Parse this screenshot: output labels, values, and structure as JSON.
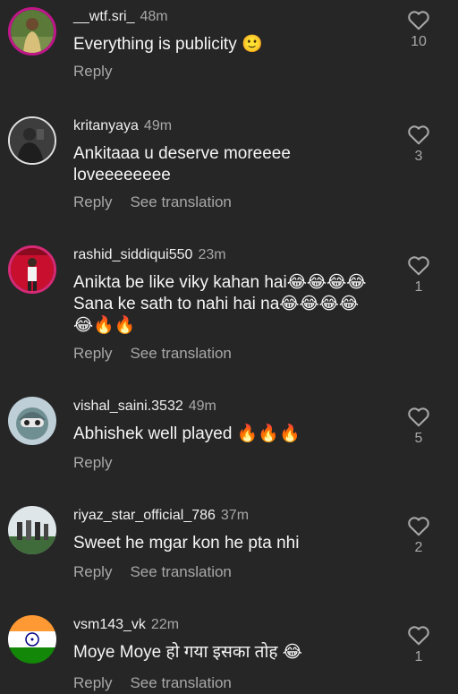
{
  "comments": [
    {
      "username": "__wtf.sri_",
      "time": "48m",
      "text": "Everything is publicity 🙂",
      "reply": "Reply",
      "likes": "10"
    },
    {
      "username": "kritanyaya",
      "time": "49m",
      "text": "Ankitaaa u deserve moreeee\nloveeeeeeee",
      "reply": "Reply",
      "translate": "See translation",
      "likes": "3"
    },
    {
      "username": "rashid_siddiqui550",
      "time": "23m",
      "text": "Anikta be like viky kahan hai😂😂😂😂\nSana ke sath to nahi hai na😂😂😂😂\n😂🔥🔥",
      "reply": "Reply",
      "translate": "See translation",
      "likes": "1"
    },
    {
      "username": "vishal_saini.3532",
      "time": "49m",
      "text": "Abhishek well played 🔥🔥🔥",
      "reply": "Reply",
      "likes": "5"
    },
    {
      "username": "riyaz_star_official_786",
      "time": "37m",
      "text": "Sweet he mgar kon he pta nhi",
      "reply": "Reply",
      "translate": "See translation",
      "likes": "2"
    },
    {
      "username": "vsm143_vk",
      "time": "22m",
      "text": "Moye Moye हो गया इसका तोह 😂",
      "reply": "Reply",
      "translate": "See translation",
      "likes": "1"
    }
  ],
  "colors": {
    "background": "#262626",
    "primary_text": "#f5f5f5",
    "secondary_text": "#a8a8a8"
  },
  "icons": {
    "like": "heart-outline-icon"
  }
}
